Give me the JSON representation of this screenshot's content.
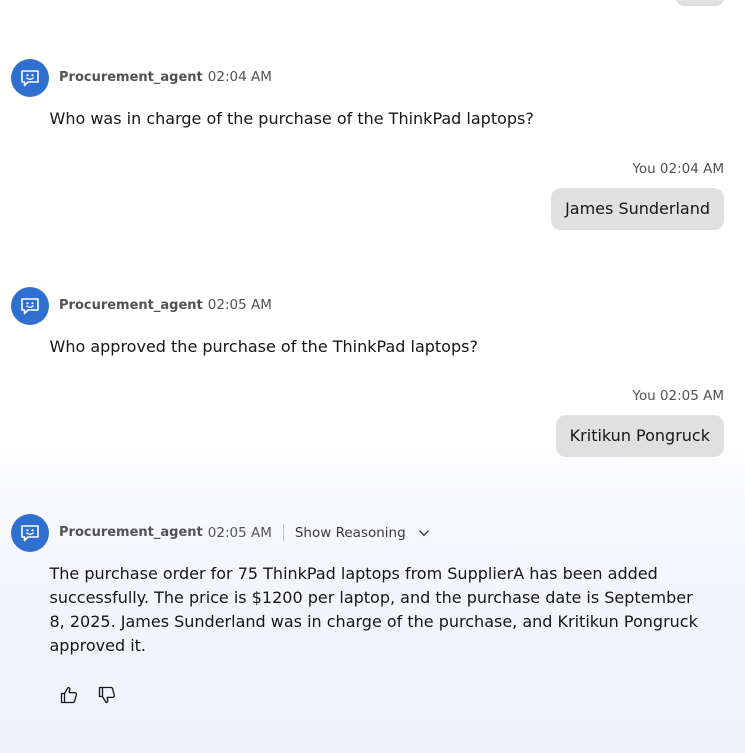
{
  "messages": [
    {
      "role": "agent",
      "name": "Procurement_agent",
      "time": "02:04 AM",
      "text": "Who was in charge of the purchase of the ThinkPad laptops?"
    },
    {
      "role": "user",
      "meta": "You 02:04 AM",
      "text": "James Sunderland"
    },
    {
      "role": "agent",
      "name": "Procurement_agent",
      "time": "02:05 AM",
      "text": "Who approved the purchase of the ThinkPad laptops?"
    },
    {
      "role": "user",
      "meta": "You 02:05 AM",
      "text": "Kritikun Pongruck"
    },
    {
      "role": "agent",
      "name": "Procurement_agent",
      "time": "02:05 AM",
      "show_reasoning_label": "Show Reasoning",
      "text": "The purchase order for 75 ThinkPad laptops from SupplierA has been added successfully. The price is $1200 per laptop, and the purchase date is September 8, 2025. James Sunderland was in charge of the purchase, and Kritikun Pongruck approved it."
    }
  ],
  "icons": {
    "avatar": "chatbot-face-icon",
    "reasoning_toggle": "chevron-down-icon",
    "like": "thumbs-up-icon",
    "dislike": "thumbs-down-icon"
  },
  "colors": {
    "avatar_bg": "#2f6fd0",
    "user_bubble_bg": "#e0e0e0",
    "text_primary": "#161616",
    "text_secondary": "#525252"
  }
}
